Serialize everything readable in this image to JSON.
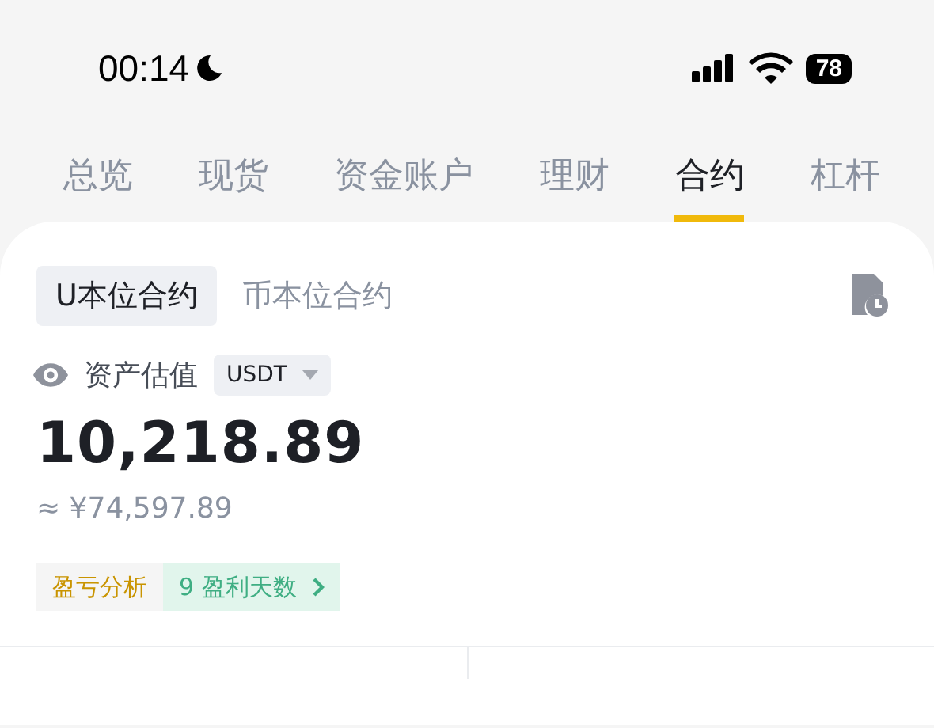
{
  "status_bar": {
    "time": "00:14",
    "battery": "78"
  },
  "tabs": [
    {
      "label": "总览",
      "selected": false
    },
    {
      "label": "现货",
      "selected": false
    },
    {
      "label": "资金账户",
      "selected": false
    },
    {
      "label": "理财",
      "selected": false
    },
    {
      "label": "合约",
      "selected": true
    },
    {
      "label": "杠杆",
      "selected": false
    }
  ],
  "contract_tabs": [
    {
      "label": "U本位合约",
      "selected": true
    },
    {
      "label": "币本位合约",
      "selected": false
    }
  ],
  "valuation": {
    "label": "资产估值",
    "currency": "USDT",
    "amount": "10,218.89",
    "converted": "≈ ¥74,597.89"
  },
  "chips": [
    {
      "kind": "plain",
      "label": "盈亏分析"
    },
    {
      "kind": "link",
      "label": "9 盈利天数"
    }
  ]
}
